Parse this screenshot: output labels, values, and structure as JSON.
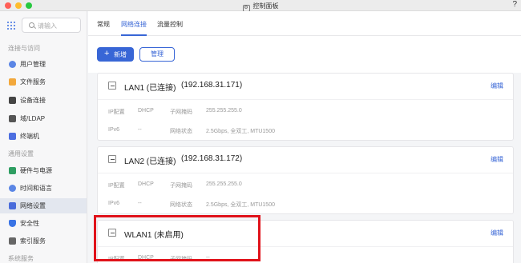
{
  "window": {
    "title": "控制面板",
    "title_icon": "control-panel-icon",
    "help": "?"
  },
  "sidebar": {
    "search_placeholder": "请输入",
    "sections": [
      {
        "label": "连接与访问"
      },
      {
        "label": "通用设置"
      },
      {
        "label": "系统服务"
      }
    ],
    "items": [
      {
        "label": "用户管理",
        "icon": "user-icon"
      },
      {
        "label": "文件服务",
        "icon": "folder-icon"
      },
      {
        "label": "设备连接",
        "icon": "device-icon"
      },
      {
        "label": "域/LDAP",
        "icon": "domain-icon"
      },
      {
        "label": "终端机",
        "icon": "terminal-icon"
      },
      {
        "label": "硬件与电源",
        "icon": "hardware-icon"
      },
      {
        "label": "时间和语言",
        "icon": "clock-icon"
      },
      {
        "label": "网络设置",
        "icon": "network-icon",
        "active": true
      },
      {
        "label": "安全性",
        "icon": "shield-icon"
      },
      {
        "label": "索引服务",
        "icon": "index-icon"
      }
    ]
  },
  "tabs": [
    {
      "label": "常规"
    },
    {
      "label": "网络连接",
      "active": true
    },
    {
      "label": "流量控制"
    }
  ],
  "toolbar": {
    "add_label": "新增",
    "add_symbol": "+",
    "manage_label": "管理"
  },
  "cards": [
    {
      "name": "LAN1 (已连接)",
      "ip": "(192.168.31.171)",
      "edit": "编辑",
      "ip_config_label": "IP配置",
      "ip_config_value": "DHCP",
      "mask_label": "子网掩码",
      "mask_value": "255.255.255.0",
      "ipv6_label": "IPv6",
      "ipv6_value": "--",
      "status_label": "网络状态",
      "status_value": "2.5Gbps, 全双工, MTU1500"
    },
    {
      "name": "LAN2 (已连接)",
      "ip": "(192.168.31.172)",
      "edit": "编辑",
      "ip_config_label": "IP配置",
      "ip_config_value": "DHCP",
      "mask_label": "子网掩码",
      "mask_value": "255.255.255.0",
      "ipv6_label": "IPv6",
      "ipv6_value": "--",
      "status_label": "网络状态",
      "status_value": "2.5Gbps, 全双工, MTU1500"
    },
    {
      "name": "WLAN1 (未启用)",
      "edit": "编辑",
      "ip_config_label": "IP配置",
      "ip_config_value": "DHCP",
      "mask_label": "子网掩码",
      "mask_value": "--"
    }
  ],
  "colors": {
    "accent": "#3866d6",
    "highlight": "#e0121a"
  }
}
